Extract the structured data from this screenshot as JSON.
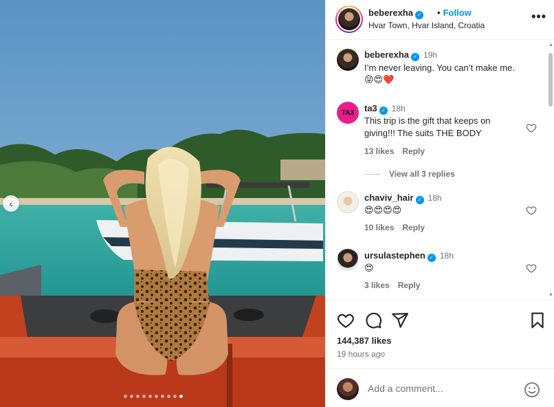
{
  "header": {
    "username": "beberexha",
    "verified_mark": "✓",
    "separator": "•",
    "follow_label": "Follow",
    "location": "Hvar Town, Hvar Island, Croatia",
    "more_label": "•••"
  },
  "media": {
    "prev_icon": "‹",
    "carousel_total": 10,
    "carousel_active": 10
  },
  "comments": [
    {
      "username": "beberexha",
      "time": "19h",
      "text": "I’m never leaving. You can’t make me.",
      "emoji": "😝😍❤️"
    },
    {
      "username": "ta3",
      "time": "18h",
      "text_line1": "This trip is the gift that keeps on",
      "text_line2": "giving!!! The suits THE BODY",
      "likes": "13 likes",
      "reply": "Reply",
      "avatar_text": "TA3",
      "view_replies": "View all 3 replies"
    },
    {
      "username": "chaviv_hair",
      "time": "18h",
      "emoji": "😍😍😍😍",
      "likes": "10 likes",
      "reply": "Reply"
    },
    {
      "username": "ursulastephen",
      "time": "18h",
      "emoji": "😍",
      "likes": "3 likes",
      "reply": "Reply"
    }
  ],
  "actions": {
    "likes": "144,387 likes",
    "time_ago": "19 hours ago"
  },
  "add_comment": {
    "placeholder": "Add a comment..."
  },
  "colors": {
    "accent": "#0095f6",
    "heart": "#ed4956",
    "muted": "#737373"
  },
  "icons": [
    "more-options-icon",
    "verified-badge-icon",
    "heart-icon",
    "comment-icon",
    "share-icon",
    "bookmark-icon",
    "emoji-icon",
    "chevron-left-icon"
  ]
}
